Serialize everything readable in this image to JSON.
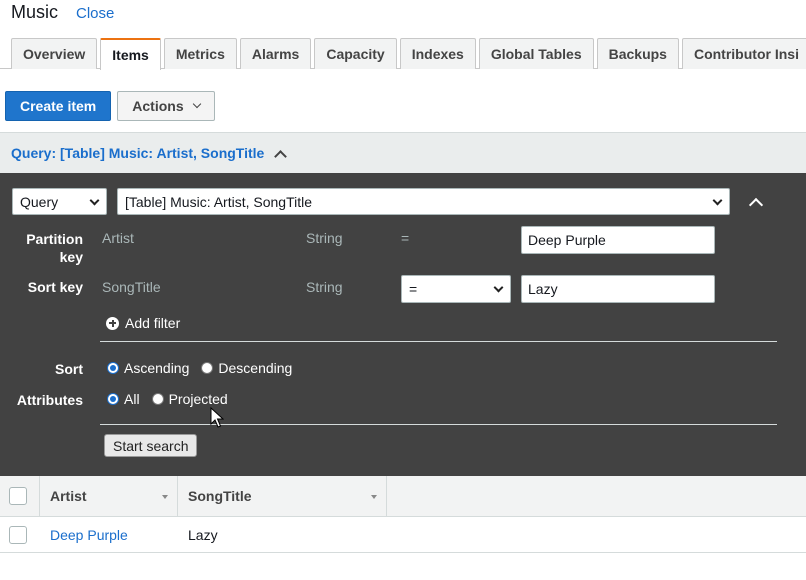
{
  "header": {
    "title": "Music",
    "close_label": "Close"
  },
  "tabs": [
    {
      "label": "Overview",
      "active": false
    },
    {
      "label": "Items",
      "active": true
    },
    {
      "label": "Metrics",
      "active": false
    },
    {
      "label": "Alarms",
      "active": false
    },
    {
      "label": "Capacity",
      "active": false
    },
    {
      "label": "Indexes",
      "active": false
    },
    {
      "label": "Global Tables",
      "active": false
    },
    {
      "label": "Backups",
      "active": false
    },
    {
      "label": "Contributor Insi",
      "active": false
    }
  ],
  "toolbar": {
    "create_label": "Create item",
    "actions_label": "Actions"
  },
  "query_bar": {
    "label": "Query: [Table] Music: Artist, SongTitle"
  },
  "query": {
    "mode_select": "Query",
    "table_select": "[Table] Music: Artist, SongTitle",
    "partition_label": "Partition key",
    "partition_attr": "Artist",
    "partition_type": "String",
    "partition_op": "=",
    "partition_value": "Deep Purple",
    "sort_key_label": "Sort key",
    "sort_attr": "SongTitle",
    "sort_type": "String",
    "sort_op": "=",
    "sort_value": "Lazy",
    "add_filter_label": "Add filter",
    "sort_label": "Sort",
    "sort_asc": "Ascending",
    "sort_desc": "Descending",
    "attributes_label": "Attributes",
    "attr_all": "All",
    "attr_projected": "Projected",
    "start_search_label": "Start search"
  },
  "results": {
    "columns": [
      "Artist",
      "SongTitle"
    ],
    "rows": [
      {
        "artist": "Deep Purple",
        "songtitle": "Lazy"
      }
    ]
  }
}
